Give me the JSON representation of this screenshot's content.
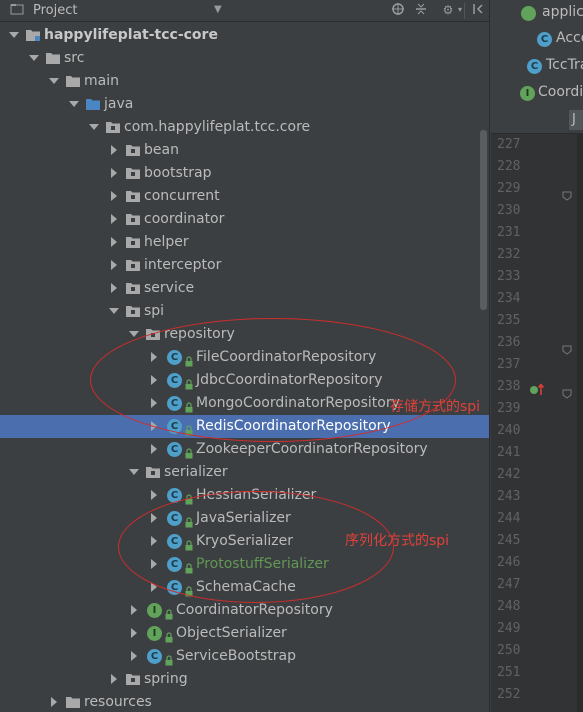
{
  "panel": {
    "title": "Project",
    "dropdown_icon": "chevron-down-icon",
    "header_icons": [
      "sync-scroll-icon",
      "collapse-all-icon",
      "gear-icon",
      "hide-panel-icon"
    ]
  },
  "tree": [
    {
      "label": "happylifeplat-tcc-core",
      "kind": "module",
      "indent": 0,
      "expanded": true
    },
    {
      "label": "src",
      "kind": "folder",
      "indent": 1,
      "expanded": true
    },
    {
      "label": "main",
      "kind": "folder",
      "indent": 2,
      "expanded": true
    },
    {
      "label": "java",
      "kind": "source-root",
      "indent": 3,
      "expanded": true
    },
    {
      "label": "com.happylifeplat.tcc.core",
      "kind": "package",
      "indent": 4,
      "expanded": true
    },
    {
      "label": "bean",
      "kind": "package",
      "indent": 5,
      "expanded": false
    },
    {
      "label": "bootstrap",
      "kind": "package",
      "indent": 5,
      "expanded": false
    },
    {
      "label": "concurrent",
      "kind": "package",
      "indent": 5,
      "expanded": false
    },
    {
      "label": "coordinator",
      "kind": "package",
      "indent": 5,
      "expanded": false
    },
    {
      "label": "helper",
      "kind": "package",
      "indent": 5,
      "expanded": false
    },
    {
      "label": "interceptor",
      "kind": "package",
      "indent": 5,
      "expanded": false
    },
    {
      "label": "service",
      "kind": "package",
      "indent": 5,
      "expanded": false
    },
    {
      "label": "spi",
      "kind": "package",
      "indent": 5,
      "expanded": true
    },
    {
      "label": "repository",
      "kind": "package",
      "indent": 6,
      "expanded": true
    },
    {
      "label": "FileCoordinatorRepository",
      "kind": "class",
      "indent": 7,
      "expanded": false
    },
    {
      "label": "JdbcCoordinatorRepository",
      "kind": "class",
      "indent": 7,
      "expanded": false
    },
    {
      "label": "MongoCoordinatorRepository",
      "kind": "class",
      "indent": 7,
      "expanded": false
    },
    {
      "label": "RedisCoordinatorRepository",
      "kind": "class",
      "indent": 7,
      "expanded": false,
      "selected": true
    },
    {
      "label": "ZookeeperCoordinatorRepository",
      "kind": "class",
      "indent": 7,
      "expanded": false
    },
    {
      "label": "serializer",
      "kind": "package",
      "indent": 6,
      "expanded": true
    },
    {
      "label": "HessianSerializer",
      "kind": "class",
      "indent": 7,
      "expanded": false
    },
    {
      "label": "JavaSerializer",
      "kind": "class",
      "indent": 7,
      "expanded": false
    },
    {
      "label": "KryoSerializer",
      "kind": "class",
      "indent": 7,
      "expanded": false
    },
    {
      "label": "ProtostuffSerializer",
      "kind": "class",
      "indent": 7,
      "expanded": false,
      "modified": true
    },
    {
      "label": "SchemaCache",
      "kind": "class",
      "indent": 7,
      "expanded": false
    },
    {
      "label": "CoordinatorRepository",
      "kind": "interface",
      "indent": 6,
      "expanded": false
    },
    {
      "label": "ObjectSerializer",
      "kind": "interface",
      "indent": 6,
      "expanded": false
    },
    {
      "label": "ServiceBootstrap",
      "kind": "class",
      "indent": 6,
      "expanded": false
    },
    {
      "label": "spring",
      "kind": "package",
      "indent": 5,
      "expanded": false
    },
    {
      "label": "resources",
      "kind": "folder",
      "indent": 2,
      "expanded": false
    }
  ],
  "annotations": [
    {
      "text": "存储方式的spi",
      "color": "#e0413a"
    },
    {
      "text": "序列化方式的spi",
      "color": "#e0413a"
    }
  ],
  "structure": [
    {
      "label": "applic",
      "icon": "spring-boot-icon"
    },
    {
      "label": "Acco",
      "icon": "class-icon"
    },
    {
      "label": "TccTra",
      "icon": "class-icon"
    },
    {
      "label": "Coordin",
      "icon": "interface-icon"
    }
  ],
  "editor": {
    "tab_label": "J",
    "line_numbers": [
      "227",
      "228",
      "229",
      "230",
      "231",
      "232",
      "233",
      "234",
      "235",
      "236",
      "237",
      "238",
      "239",
      "240",
      "241",
      "242",
      "243",
      "244",
      "245",
      "246",
      "247",
      "248",
      "249",
      "250",
      "251",
      "252"
    ],
    "override_marker_line": "238"
  },
  "colors": {
    "panel_bg": "#3c3f41",
    "selection": "#4b6eaf",
    "annotation": "#d22c2c",
    "class_icon": "#4e9fc9",
    "interface_icon": "#62a35b"
  }
}
